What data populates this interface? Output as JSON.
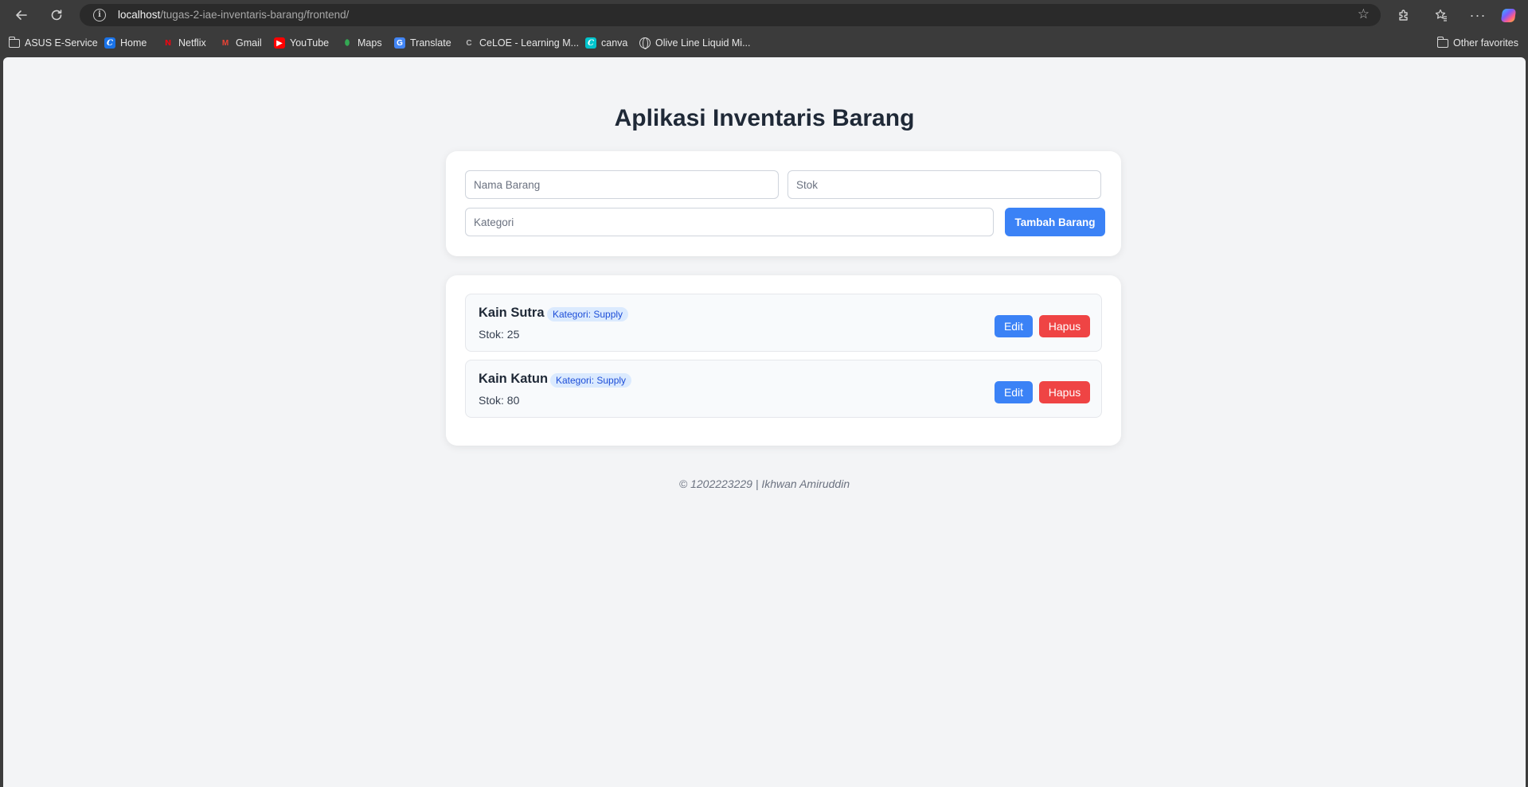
{
  "browser": {
    "url_host": "localhost",
    "url_path": "/tugas-2-iae-inventaris-barang/frontend/",
    "icons": {
      "back": "arrow-left-icon",
      "reload": "reload-icon",
      "info": "info-icon",
      "favorite": "star-icon",
      "extensions": "puzzle-icon",
      "favorites": "favorites-icon",
      "more": "more-icon",
      "copilot": "copilot-icon"
    },
    "bookmarks": [
      {
        "label": "ASUS E-Service",
        "icon": "folder-icon"
      },
      {
        "label": "Home",
        "icon": "celoe-c-icon"
      },
      {
        "label": "Netflix",
        "icon": "netflix-icon"
      },
      {
        "label": "Gmail",
        "icon": "gmail-icon"
      },
      {
        "label": "YouTube",
        "icon": "youtube-icon"
      },
      {
        "label": "Maps",
        "icon": "maps-icon"
      },
      {
        "label": "Translate",
        "icon": "translate-icon"
      },
      {
        "label": "CeLOE - Learning M...",
        "icon": "celoe-icon"
      },
      {
        "label": "canva",
        "icon": "canva-icon"
      },
      {
        "label": "Olive Line Liquid Mi...",
        "icon": "globe-icon"
      }
    ],
    "other_favorites": "Other favorites"
  },
  "app": {
    "title": "Aplikasi Inventaris Barang",
    "form": {
      "nama_placeholder": "Nama Barang",
      "stok_placeholder": "Stok",
      "kategori_placeholder": "Kategori",
      "add_button": "Tambah Barang"
    },
    "items": [
      {
        "name": "Kain Sutra",
        "category": "Kategori: Supply",
        "stock": "Stok: 25",
        "edit": "Edit",
        "delete": "Hapus"
      },
      {
        "name": "Kain Katun",
        "category": "Kategori: Supply",
        "stock": "Stok: 80",
        "edit": "Edit",
        "delete": "Hapus"
      }
    ],
    "footer": "© 1202223229 | Ikhwan Amiruddin"
  },
  "colors": {
    "primary": "#3b82f6",
    "danger": "#ef4444",
    "page_bg": "#f3f4f6",
    "badge_bg": "#dbeafe"
  }
}
